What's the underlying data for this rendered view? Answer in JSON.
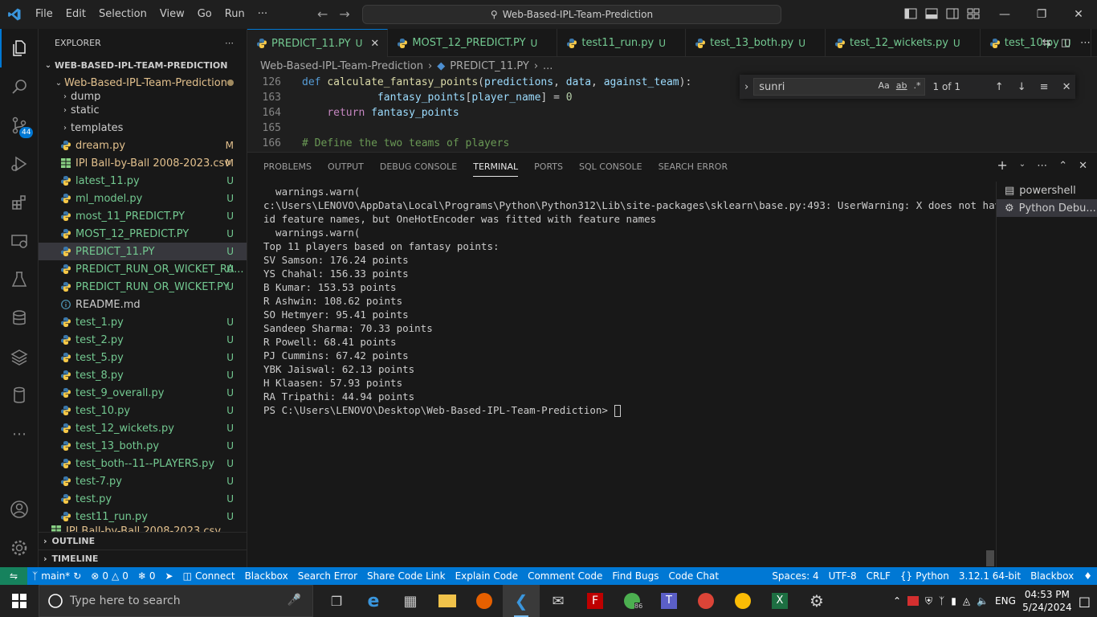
{
  "titlebar": {
    "menu": [
      "File",
      "Edit",
      "Selection",
      "View",
      "Go",
      "Run",
      "···"
    ],
    "command_center": "Web-Based-IPL-Team-Prediction"
  },
  "activity": {
    "source_control_badge": "44"
  },
  "explorer": {
    "header": "EXPLORER",
    "root": "WEB-BASED-IPL-TEAM-PREDICTION",
    "folder": "Web-Based-IPL-Team-Prediction",
    "items": [
      {
        "name": "dump",
        "kind": "folder",
        "status": ""
      },
      {
        "name": "static",
        "kind": "folder",
        "status": ""
      },
      {
        "name": "templates",
        "kind": "folder",
        "status": ""
      },
      {
        "name": "dream.py",
        "kind": "py",
        "status": "M"
      },
      {
        "name": "IPl Ball-by-Ball 2008-2023.csv",
        "kind": "csv",
        "status": "M"
      },
      {
        "name": "latest_11.py",
        "kind": "py",
        "status": "U"
      },
      {
        "name": "ml_model.py",
        "kind": "py",
        "status": "U"
      },
      {
        "name": "most_11_PREDICT.PY",
        "kind": "py",
        "status": "U"
      },
      {
        "name": "MOST_12_PREDICT.PY",
        "kind": "py",
        "status": "U"
      },
      {
        "name": "PREDICT_11.PY",
        "kind": "py",
        "status": "U"
      },
      {
        "name": "PREDICT_RUN_OR_WICKET_RA...",
        "kind": "py",
        "status": "U"
      },
      {
        "name": "PREDICT_RUN_OR_WICKET.PY",
        "kind": "py",
        "status": "U"
      },
      {
        "name": "README.md",
        "kind": "md",
        "status": ""
      },
      {
        "name": "test_1.py",
        "kind": "py",
        "status": "U"
      },
      {
        "name": "test_2.py",
        "kind": "py",
        "status": "U"
      },
      {
        "name": "test_5.py",
        "kind": "py",
        "status": "U"
      },
      {
        "name": "test_8.py",
        "kind": "py",
        "status": "U"
      },
      {
        "name": "test_9_overall.py",
        "kind": "py",
        "status": "U"
      },
      {
        "name": "test_10.py",
        "kind": "py",
        "status": "U"
      },
      {
        "name": "test_12_wickets.py",
        "kind": "py",
        "status": "U"
      },
      {
        "name": "test_13_both.py",
        "kind": "py",
        "status": "U"
      },
      {
        "name": "test_both--11--PLAYERS.py",
        "kind": "py",
        "status": "U"
      },
      {
        "name": "test-7.py",
        "kind": "py",
        "status": "U"
      },
      {
        "name": "test.py",
        "kind": "py",
        "status": "U"
      },
      {
        "name": "test11_run.py",
        "kind": "py",
        "status": "U"
      },
      {
        "name": "IPl Ball-by-Ball 2008-2023.csv",
        "kind": "csv",
        "status": ""
      }
    ],
    "outline": "OUTLINE",
    "timeline": "TIMELINE"
  },
  "tabs": [
    {
      "label": "PREDICT_11.PY",
      "status": "U",
      "active": true
    },
    {
      "label": "MOST_12_PREDICT.PY",
      "status": "U",
      "active": false
    },
    {
      "label": "test11_run.py",
      "status": "U",
      "active": false
    },
    {
      "label": "test_13_both.py",
      "status": "U",
      "active": false
    },
    {
      "label": "test_12_wickets.py",
      "status": "U",
      "active": false
    },
    {
      "label": "test_10.py",
      "status": "U",
      "active": false
    }
  ],
  "breadcrumb": {
    "folder": "Web-Based-IPL-Team-Prediction",
    "file": "PREDICT_11.PY",
    "rest": "..."
  },
  "code": [
    {
      "ln": "126",
      "tokens": [
        [
          "kw",
          "def "
        ],
        [
          "fn",
          "calculate_fantasy_points"
        ],
        [
          "pl",
          "("
        ],
        [
          "var",
          "predictions"
        ],
        [
          "pl",
          ", "
        ],
        [
          "var",
          "data"
        ],
        [
          "pl",
          ", "
        ],
        [
          "var",
          "against_team"
        ],
        [
          "pl",
          "):"
        ]
      ]
    },
    {
      "ln": "163",
      "tokens": [
        [
          "pl",
          "            "
        ],
        [
          "var",
          "fantasy_points"
        ],
        [
          "pl",
          "["
        ],
        [
          "var",
          "player_name"
        ],
        [
          "pl",
          "] = "
        ],
        [
          "num",
          "0"
        ]
      ]
    },
    {
      "ln": "164",
      "tokens": [
        [
          "pl",
          "    "
        ],
        [
          "kw2",
          "return "
        ],
        [
          "var",
          "fantasy_points"
        ]
      ]
    },
    {
      "ln": "165",
      "tokens": []
    },
    {
      "ln": "166",
      "tokens": [
        [
          "cm",
          "# Define the two teams of players"
        ]
      ]
    }
  ],
  "find": {
    "query": "sunri",
    "count": "1 of 1",
    "opt_case": "Aa",
    "opt_word": "ab",
    "opt_regex": ".*"
  },
  "panel": {
    "tabs": [
      "PROBLEMS",
      "OUTPUT",
      "DEBUG CONSOLE",
      "TERMINAL",
      "PORTS",
      "SQL CONSOLE",
      "SEARCH ERROR"
    ],
    "active_tab": "TERMINAL",
    "terminals": [
      "powershell",
      "Python Debu..."
    ]
  },
  "terminal_lines": [
    "  warnings.warn(",
    "c:\\Users\\LENOVO\\AppData\\Local\\Programs\\Python\\Python312\\Lib\\site-packages\\sklearn\\base.py:493: UserWarning: X does not have val",
    "id feature names, but OneHotEncoder was fitted with feature names",
    "  warnings.warn(",
    "Top 11 players based on fantasy points:",
    "SV Samson: 176.24 points",
    "YS Chahal: 156.33 points",
    "B Kumar: 153.53 points",
    "R Ashwin: 108.62 points",
    "SO Hetmyer: 95.41 points",
    "Sandeep Sharma: 70.33 points",
    "R Powell: 68.41 points",
    "PJ Cummins: 67.42 points",
    "YBK Jaiswal: 62.13 points",
    "H Klaasen: 57.93 points",
    "RA Tripathi: 44.94 points",
    "PS C:\\Users\\LENOVO\\Desktop\\Web-Based-IPL-Team-Prediction> "
  ],
  "statusbar": {
    "branch": "main*",
    "errors": "0",
    "warnings": "0",
    "ports": "0",
    "left_items": [
      "Connect",
      "Blackbox",
      "Search Error",
      "Share Code Link",
      "Explain Code",
      "Comment Code",
      "Find Bugs",
      "Code Chat"
    ],
    "spaces": "Spaces: 4",
    "encoding": "UTF-8",
    "eol": "CRLF",
    "language": "Python",
    "interpreter": "3.12.1 64-bit",
    "blackbox": "Blackbox"
  },
  "taskbar": {
    "search_placeholder": "Type here to search",
    "lang": "ENG",
    "time": "04:53 PM",
    "date": "5/24/2024",
    "chrome_badge": "86"
  },
  "colors": {
    "accent": "#0078d4",
    "untracked": "#73c991",
    "modified": "#e2c08d"
  }
}
